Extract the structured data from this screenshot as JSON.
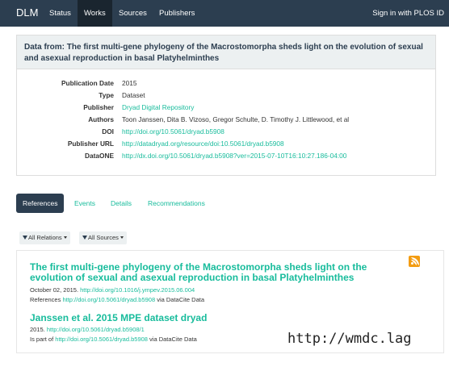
{
  "navbar": {
    "brand": "DLM",
    "items": [
      {
        "label": "Status"
      },
      {
        "label": "Works"
      },
      {
        "label": "Sources"
      },
      {
        "label": "Publishers"
      }
    ],
    "active_item": "Works",
    "signin": "Sign in with PLOS ID"
  },
  "panel": {
    "title": "Data from: The first multi-gene phylogeny of the Macrostomorpha sheds light on the evolution of sexual and asexual reproduction in basal Platyhelminthes",
    "rows": [
      {
        "label": "Publication Date",
        "value": "2015"
      },
      {
        "label": "Type",
        "value": "Dataset"
      },
      {
        "label": "Publisher",
        "value": "Dryad Digital Repository"
      },
      {
        "label": "Authors",
        "value": "Toon Janssen, Dita B. Vizoso, Gregor Schulte, D. Timothy J. Littlewood, et al"
      },
      {
        "label": "DOI",
        "value": "http://doi.org/10.5061/dryad.b5908"
      },
      {
        "label": "Publisher URL",
        "value": "http://datadryad.org/resource/doi:10.5061/dryad.b5908"
      },
      {
        "label": "DataONE",
        "value": "http://dx.doi.org/10.5061/dryad.b5908?ver=2015-07-10T16:10:27.186-04:00"
      }
    ]
  },
  "tabs": {
    "items": [
      {
        "label": "References"
      },
      {
        "label": "Events"
      },
      {
        "label": "Details"
      },
      {
        "label": "Recommendations"
      }
    ],
    "active": "References"
  },
  "filters": {
    "relations": "All Relations",
    "sources": "All Sources"
  },
  "results": [
    {
      "title": "The first multi-gene phylogeny of the Macrostomorpha sheds light on the evolution of sexual and asexual reproduction in basal Platyhelminthes",
      "date": "October 02, 2015.",
      "doi": "http://doi.org/10.1016/j.ympev.2015.06.004",
      "relation": "References",
      "relation_link": "http://doi.org/10.5061/dryad.b5908",
      "via": "via DataCite Data"
    },
    {
      "title": "Janssen et al. 2015 MPE dataset dryad",
      "date": "2015.",
      "doi": "http://doi.org/10.5061/dryad.b5908/1",
      "relation": "Is part of",
      "relation_link": "http://doi.org/10.5061/dryad.b5908",
      "via": "via DataCite Data"
    }
  ],
  "overlay_text": "http://wmdc.lag",
  "icons": {
    "rss": "rss-feed-icon",
    "filter": "funnel-icon"
  },
  "colors": {
    "navbar": "#2c3e50",
    "accent": "#18bc9c",
    "rss": "#f39c12",
    "panel_heading": "#ecf0f1"
  }
}
